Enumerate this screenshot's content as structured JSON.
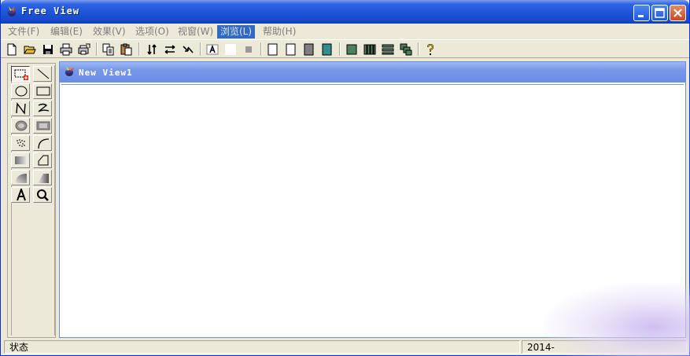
{
  "window": {
    "title": "Free View"
  },
  "menu": {
    "items": [
      {
        "label": "文件(F)"
      },
      {
        "label": "编辑(E)"
      },
      {
        "label": "效果(V)"
      },
      {
        "label": "选项(O)"
      },
      {
        "label": "视窗(W)"
      },
      {
        "label": "浏览(L)"
      },
      {
        "label": "帮助(H)"
      }
    ],
    "active_index": 5
  },
  "toolbar": {
    "icons": [
      "new-file-icon",
      "open-folder-icon",
      "save-icon",
      "print-icon",
      "print-preview-icon",
      "copy-icon",
      "paste-icon",
      "flip-vertical-icon",
      "flip-horizontal-icon",
      "rotate-icon",
      "text-icon",
      "white-swatch-icon",
      "gray-swatch-icon",
      "frame-icon",
      "page-icon",
      "dark-gray-square-icon",
      "teal-square-icon",
      "fill-square-icon",
      "columns-icon",
      "rows-icon",
      "stack-icon",
      "help-icon"
    ]
  },
  "tools": {
    "icons": [
      "rectangle-select-icon",
      "line-icon",
      "ellipse-icon",
      "rectangle-icon",
      "polyline-icon",
      "freehand-icon",
      "filled-ellipse-icon",
      "filled-rect-icon",
      "spray-icon",
      "arc-icon",
      "gradient-rect-icon",
      "polygon-icon",
      "radial-gradient-icon",
      "shade-gradient-icon",
      "text-tool-icon",
      "zoom-icon"
    ]
  },
  "document": {
    "title": "New View1"
  },
  "status": {
    "text": "状态",
    "date": "2014-"
  },
  "colors": {
    "title_blue": "#1f56d8",
    "mdi_title": "#7696e8",
    "menu_active": "#316ac5",
    "chrome": "#ece9d8"
  }
}
